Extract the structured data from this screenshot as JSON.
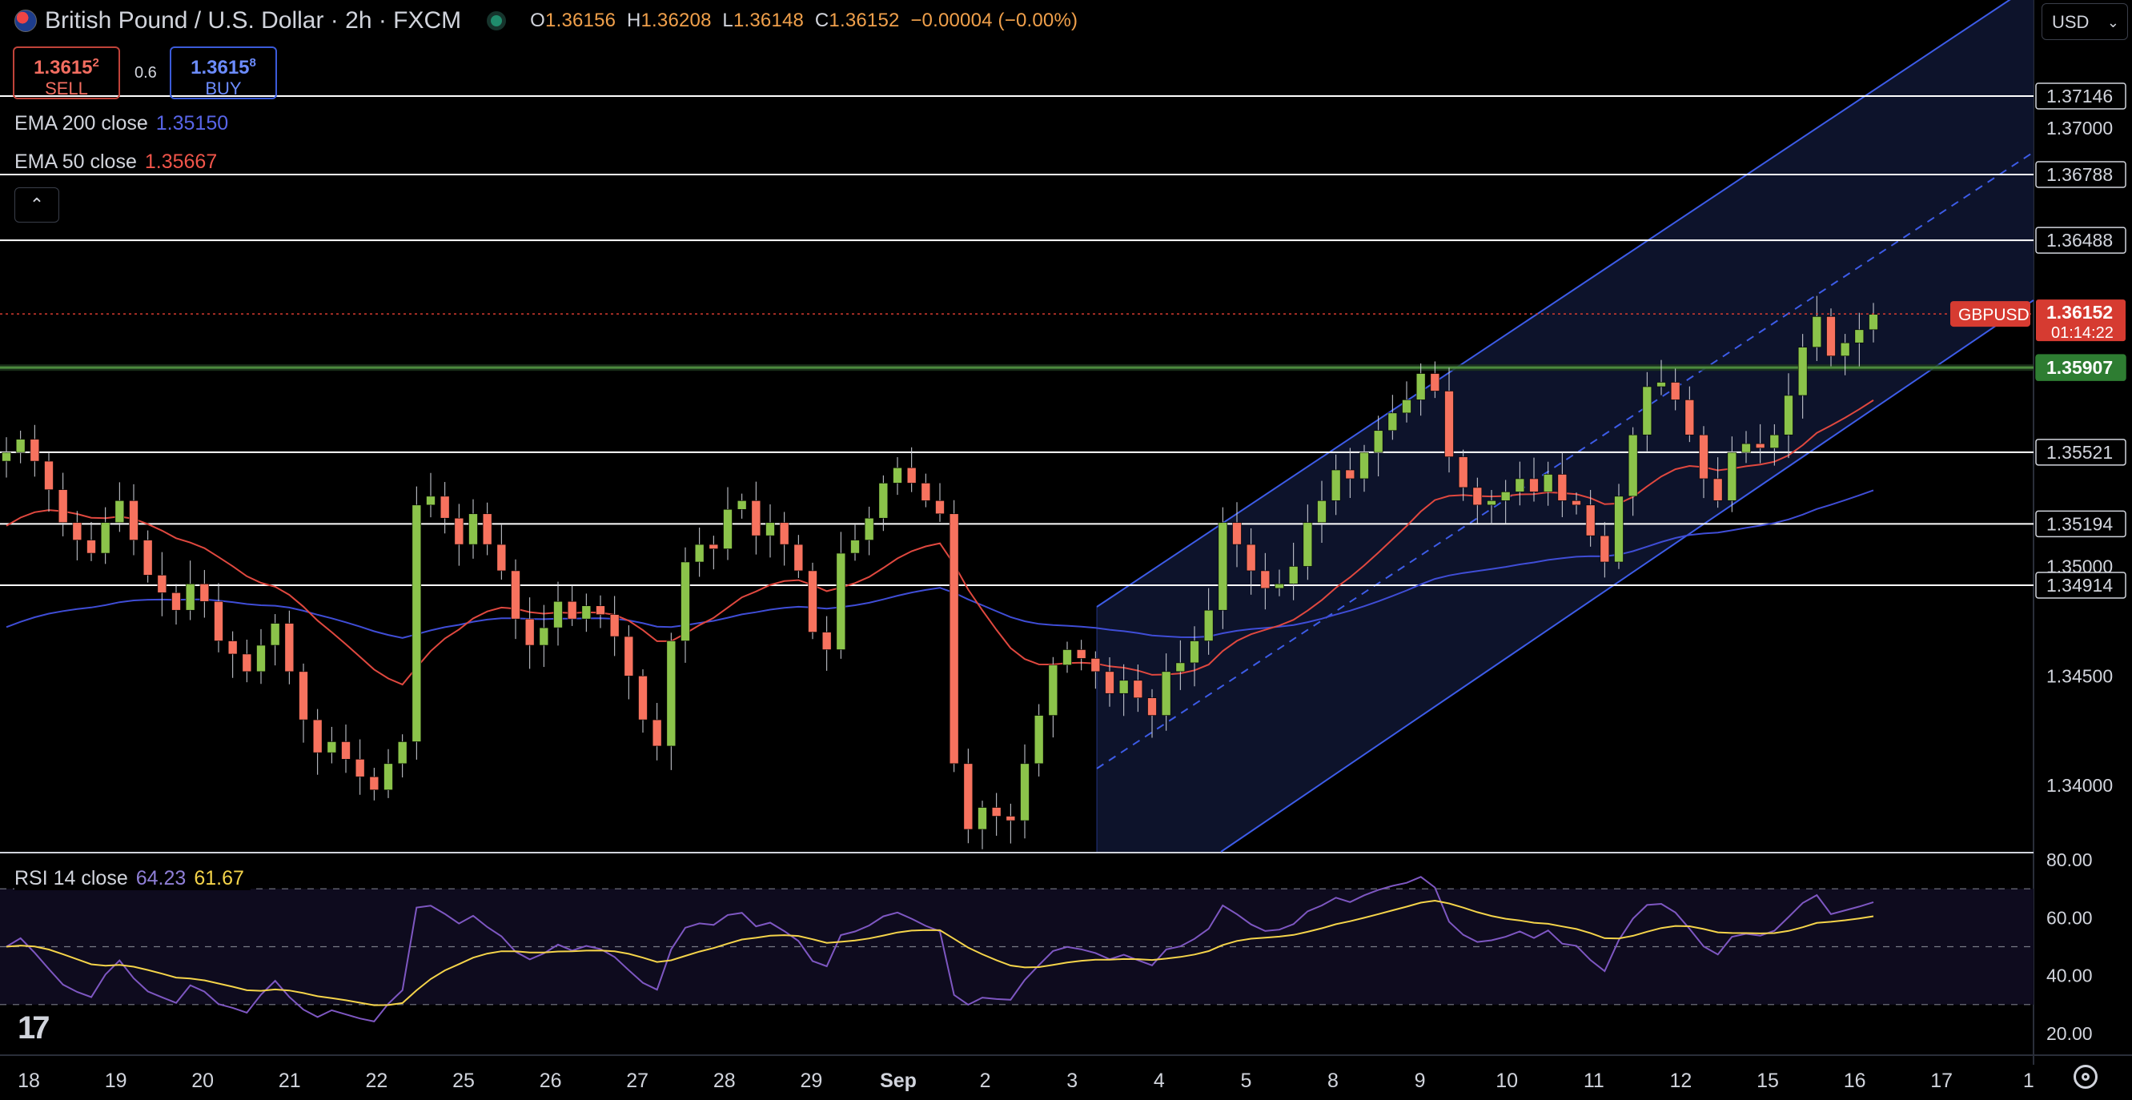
{
  "header": {
    "symbol_title": "British Pound / U.S. Dollar · 2h · FXCM",
    "ohlc": {
      "o_label": "O",
      "o": "1.36156",
      "h_label": "H",
      "h": "1.36208",
      "l_label": "L",
      "l": "1.36148",
      "c_label": "C",
      "c": "1.36152",
      "change": "−0.00004 (−0.00%)"
    }
  },
  "trade": {
    "sell_price_main": "1.3615",
    "sell_price_sup": "2",
    "sell_label": "SELL",
    "spread": "0.6",
    "buy_price_main": "1.3615",
    "buy_price_sup": "8",
    "buy_label": "BUY"
  },
  "indicators": {
    "ema200": {
      "label": "EMA 200 close",
      "value": "1.35150",
      "color": "#3f4dd6"
    },
    "ema50": {
      "label": "EMA 50 close",
      "value": "1.35667",
      "color": "#e0483f"
    },
    "rsi": {
      "label": "RSI 14 close",
      "value": "64.23",
      "ma_value": "61.67",
      "color": "#7e57c2",
      "ma_color": "#f5d44a"
    }
  },
  "currency_selector": {
    "value": "USD"
  },
  "colors": {
    "up": "#8bc34a",
    "down": "#f7725e",
    "channel": "#3d5ce8",
    "hline": "#ffffff",
    "support": "#4c8a3e",
    "price_tag": "#d63b31"
  },
  "chart_data": {
    "type": "candlestick",
    "symbol": "GBPUSD",
    "timeframe": "2h",
    "x_ticks": [
      "18",
      "19",
      "20",
      "21",
      "22",
      "25",
      "26",
      "27",
      "28",
      "29",
      "Sep",
      "2",
      "3",
      "4",
      "5",
      "8",
      "9",
      "10",
      "11",
      "12",
      "15",
      "16",
      "17",
      "1"
    ],
    "price_axis": {
      "ylim": [
        1.338,
        1.378
      ],
      "ticks": [
        "1.37000",
        "1.35000",
        "1.34500",
        "1.34000"
      ]
    },
    "horizontal_levels": [
      {
        "value": 1.37146,
        "label": "1.37146"
      },
      {
        "value": 1.36788,
        "label": "1.36788"
      },
      {
        "value": 1.36488,
        "label": "1.36488"
      },
      {
        "value": 1.35907,
        "label": "1.35907",
        "style": "support"
      },
      {
        "value": 1.35521,
        "label": "1.35521"
      },
      {
        "value": 1.35194,
        "label": "1.35194"
      },
      {
        "value": 1.34914,
        "label": "1.34914"
      }
    ],
    "last_price": {
      "symbol": "GBPUSD",
      "value": 1.36152,
      "label": "1.36152",
      "countdown": "01:14:22"
    },
    "ema50_last": 1.35667,
    "ema200_last": 1.3515,
    "close_series": [
      1.3552,
      1.3558,
      1.3548,
      1.3535,
      1.352,
      1.3512,
      1.3506,
      1.352,
      1.353,
      1.3512,
      1.3496,
      1.3488,
      1.348,
      1.3492,
      1.3484,
      1.3466,
      1.346,
      1.3452,
      1.3464,
      1.3474,
      1.3452,
      1.343,
      1.3415,
      1.342,
      1.3412,
      1.3404,
      1.3398,
      1.341,
      1.342,
      1.3528,
      1.3532,
      1.3522,
      1.351,
      1.3524,
      1.351,
      1.3498,
      1.3476,
      1.3464,
      1.3472,
      1.3484,
      1.3476,
      1.3482,
      1.3478,
      1.3468,
      1.345,
      1.343,
      1.3418,
      1.3466,
      1.3502,
      1.351,
      1.3508,
      1.3526,
      1.353,
      1.3514,
      1.352,
      1.351,
      1.3498,
      1.347,
      1.3462,
      1.3506,
      1.3512,
      1.3522,
      1.3538,
      1.3545,
      1.3538,
      1.353,
      1.3524,
      1.341,
      1.338,
      1.339,
      1.3386,
      1.3384,
      1.341,
      1.3432,
      1.3455,
      1.3462,
      1.3458,
      1.3452,
      1.3442,
      1.3448,
      1.344,
      1.3432,
      1.3452,
      1.3456,
      1.3466,
      1.348,
      1.352,
      1.351,
      1.3498,
      1.349,
      1.3492,
      1.35,
      1.352,
      1.353,
      1.3544,
      1.354,
      1.3552,
      1.3562,
      1.357,
      1.3576,
      1.3588,
      1.358,
      1.355,
      1.3536,
      1.3528,
      1.353,
      1.3534,
      1.354,
      1.3534,
      1.3542,
      1.353,
      1.3528,
      1.3514,
      1.3502,
      1.3532,
      1.356,
      1.3582,
      1.3584,
      1.3576,
      1.356,
      1.354,
      1.353,
      1.3552,
      1.3556,
      1.3554,
      1.356,
      1.3578,
      1.36,
      1.3614,
      1.3596,
      1.3602,
      1.3608,
      1.3615
    ],
    "rsi_axis": {
      "ylim": [
        15,
        85
      ],
      "ticks": [
        "80.00",
        "60.00",
        "40.00",
        "20.00"
      ],
      "bands": [
        30,
        50,
        70
      ]
    }
  }
}
